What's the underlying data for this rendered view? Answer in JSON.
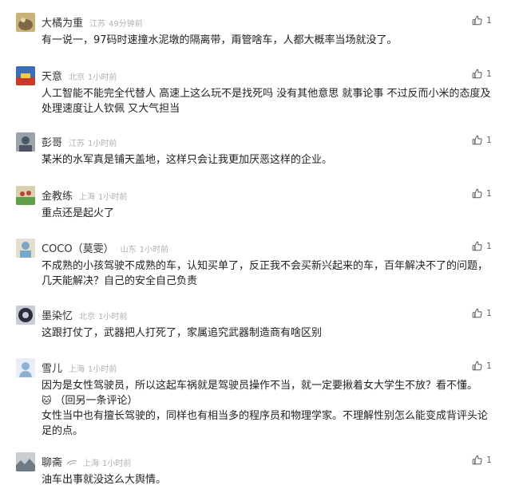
{
  "comments": [
    {
      "user": "大橘为重",
      "location": "江苏",
      "time": "49分钟前",
      "text": [
        "有一说一，97码时速撞水泥墩的隔离带，甭管啥车，人都大概率当场就没了。"
      ],
      "likes": "1",
      "avatar_colors": [
        "#c9b27a",
        "#7d6a45"
      ]
    },
    {
      "user": "天意",
      "location": "北京",
      "time": "1小时前",
      "text": [
        "人工智能不能完全代替人  高速上这么玩不是找死吗  没有其他意思   就事论事  不过反而小米的态度及处理速度让人钦佩  又大气担当"
      ],
      "likes": "1",
      "avatar_colors": [
        "#3a6fb8",
        "#c83a2c"
      ]
    },
    {
      "user": "彭哥",
      "location": "江苏",
      "time": "1小时前",
      "text": [
        "某米的水军真是铺天盖地，这样只会让我更加厌恶这样的企业。"
      ],
      "likes": "1",
      "avatar_colors": [
        "#9aa3ad",
        "#4d5560"
      ]
    },
    {
      "user": "金教练",
      "location": "上海",
      "time": "1小时前",
      "text": [
        "重点还是起火了"
      ],
      "likes": "1",
      "avatar_colors": [
        "#5f9e4a",
        "#d8d0b0"
      ]
    },
    {
      "user": "COCO（莫雯）",
      "location": "山东",
      "time": "1小时前",
      "text": [
        "不成熟的小孩驾驶不成熟的车，认知买单了，反正我不会买新兴起来的车，百年解决不了的问题，几天能解决？自己的安全自己负责"
      ],
      "likes": "1",
      "avatar_colors": [
        "#7aa6c9",
        "#e6ddd0"
      ]
    },
    {
      "user": "墨染忆",
      "location": "北京",
      "time": "1小时前",
      "text": [
        "这跟打仗了，武器把人打死了，家属追究武器制造商有啥区别"
      ],
      "likes": "1",
      "avatar_colors": [
        "#2a2e38",
        "#c8ccd6"
      ]
    },
    {
      "user": "雪儿",
      "location": "上海",
      "time": "1小时前",
      "text": [
        "因为是女性驾驶员，所以这起车祸就是驾驶员操作不当，就一定要揪着女大学生不放？看不懂。",
        "（回另一条评论）",
        "女性当中也有擅长驾驶的，同样也有相当多的程序员和物理学家。不理解性别怎么能变成背评头论足的点。"
      ],
      "likes": "1",
      "avatar_colors": [
        "#e7eef6",
        "#8fb0d6"
      ]
    },
    {
      "user": "聊斋",
      "location": "上海",
      "time": "1小时前",
      "text": [
        "油车出事就没这么大舆情。"
      ],
      "likes": "1",
      "avatar_colors": [
        "#c9ced3",
        "#6f7a82"
      ]
    }
  ]
}
